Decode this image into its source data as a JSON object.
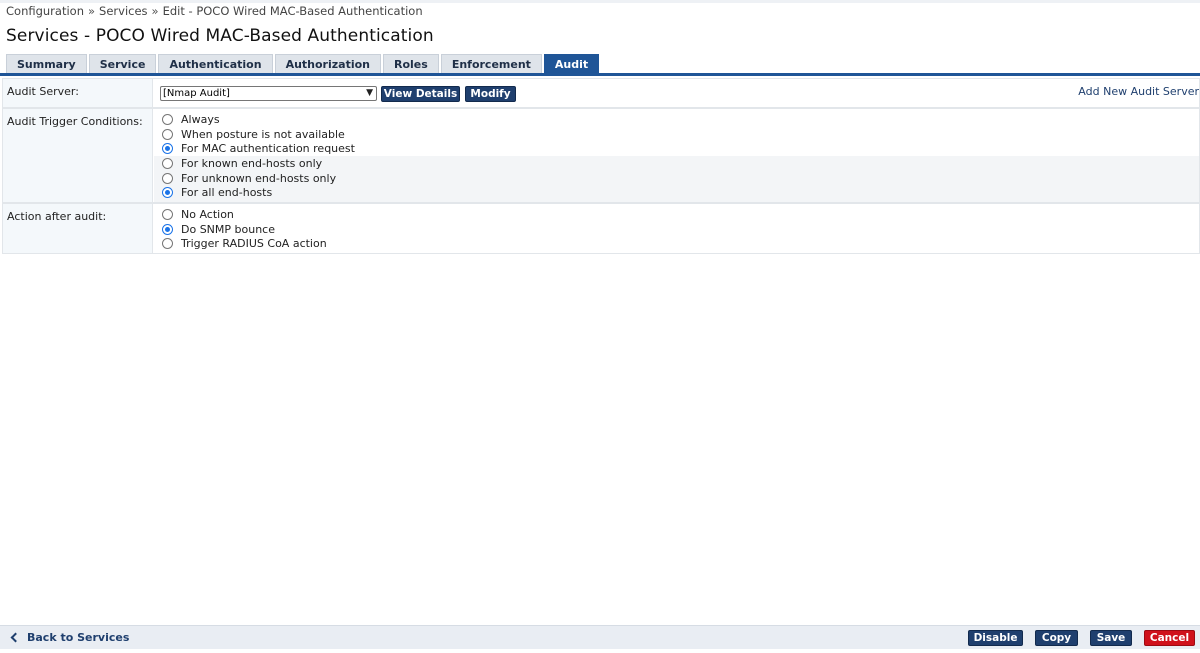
{
  "breadcrumb": [
    "Configuration",
    "Services",
    "Edit - POCO Wired MAC-Based Authentication"
  ],
  "breadcrumb_separator": "»",
  "page_title": "Services - POCO Wired MAC-Based Authentication",
  "tabs": [
    {
      "label": "Summary"
    },
    {
      "label": "Service"
    },
    {
      "label": "Authentication"
    },
    {
      "label": "Authorization"
    },
    {
      "label": "Roles"
    },
    {
      "label": "Enforcement"
    },
    {
      "label": "Audit",
      "active": true
    }
  ],
  "audit_server": {
    "label": "Audit Server:",
    "selected": "[Nmap Audit]",
    "view_details": "View Details",
    "modify": "Modify",
    "add_new": "Add New Audit Server"
  },
  "trigger_conditions": {
    "label": "Audit Trigger Conditions:",
    "options": [
      {
        "label": "Always",
        "checked": false
      },
      {
        "label": "When posture is not available",
        "checked": false
      },
      {
        "label": "For MAC authentication request",
        "checked": true
      },
      {
        "label": "For known end-hosts only",
        "checked": false
      },
      {
        "label": "For unknown end-hosts only",
        "checked": false
      },
      {
        "label": "For all end-hosts",
        "checked": true
      }
    ]
  },
  "action_after_audit": {
    "label": "Action after audit:",
    "options": [
      {
        "label": "No Action",
        "checked": false
      },
      {
        "label": "Do SNMP bounce",
        "checked": true
      },
      {
        "label": "Trigger RADIUS CoA action",
        "checked": false
      }
    ]
  },
  "footer": {
    "back": "Back to Services",
    "disable": "Disable",
    "copy": "Copy",
    "save": "Save",
    "cancel": "Cancel"
  },
  "colors": {
    "accent": "#1f5597",
    "button": "#1f3f6e",
    "cancel": "#d0111b"
  }
}
